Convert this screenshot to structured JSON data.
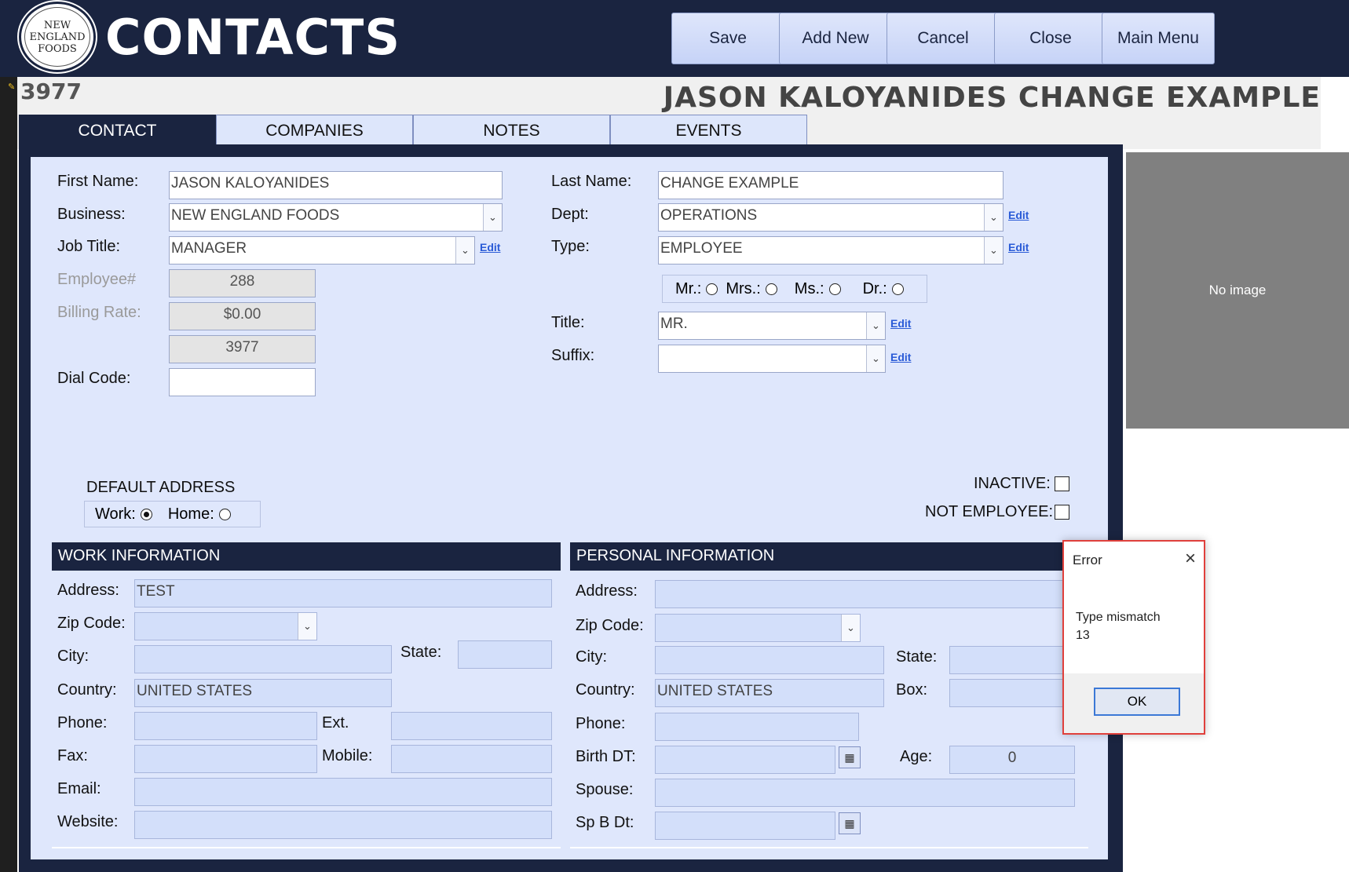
{
  "header": {
    "logo_lines": [
      "NEW",
      "ENGLAND",
      "FOODS"
    ],
    "title": "CONTACTS",
    "buttons": [
      "Save",
      "Add New",
      "Cancel",
      "Close",
      "Main Menu"
    ]
  },
  "record": {
    "id": "3977",
    "full_name": "JASON KALOYANIDES CHANGE EXAMPLE"
  },
  "tabs": [
    "CONTACT",
    "COMPANIES",
    "NOTES",
    "EVENTS"
  ],
  "contact": {
    "first_name_label": "First Name:",
    "first_name": "JASON KALOYANIDES",
    "business_label": "Business:",
    "business": "NEW ENGLAND FOODS",
    "job_title_label": "Job Title:",
    "job_title": "MANAGER",
    "employee_label": "Employee#",
    "employee_no": "288",
    "billing_label": "Billing Rate:",
    "billing_rate": "$0.00",
    "contact_id": "3977",
    "dial_code_label": "Dial Code:",
    "dial_code": "",
    "last_name_label": "Last Name:",
    "last_name": "CHANGE EXAMPLE",
    "dept_label": "Dept:",
    "dept": "OPERATIONS",
    "type_label": "Type:",
    "type": "EMPLOYEE",
    "edit_label": "Edit",
    "salutations": [
      "Mr.:",
      "Mrs.:",
      "Ms.:",
      "Dr.:"
    ],
    "title_label": "Title:",
    "title": "MR.",
    "suffix_label": "Suffix:",
    "suffix": "",
    "default_address_label": "DEFAULT ADDRESS",
    "work_label": "Work:",
    "home_label": "Home:",
    "inactive_label": "INACTIVE:",
    "not_employee_label": "NOT EMPLOYEE:"
  },
  "work": {
    "heading": "WORK INFORMATION",
    "address_label": "Address:",
    "address": "TEST",
    "zip_label": "Zip Code:",
    "zip": "",
    "city_label": "City:",
    "city": "",
    "state_label": "State:",
    "state": "",
    "country_label": "Country:",
    "country": "UNITED STATES",
    "phone_label": "Phone:",
    "ext_label": "Ext.",
    "fax_label": "Fax:",
    "mobile_label": "Mobile:",
    "email_label": "Email:",
    "website_label": "Website:"
  },
  "personal": {
    "heading": "PERSONAL INFORMATION",
    "address_label": "Address:",
    "zip_label": "Zip Code:",
    "city_label": "City:",
    "state_label": "State:",
    "country_label": "Country:",
    "country": "UNITED STATES",
    "box_label": "Box:",
    "phone_label": "Phone:",
    "birth_label": "Birth DT:",
    "age_label": "Age:",
    "age": "0",
    "spouse_label": "Spouse:",
    "spbdt_label": "Sp B Dt:"
  },
  "image_placeholder": "No image",
  "dialog": {
    "title": "Error",
    "message": "Type mismatch",
    "code": "13",
    "ok": "OK"
  },
  "icons": {
    "dropdown": "chevron-down-icon",
    "calendar": "calendar-icon",
    "close": "close-icon",
    "pencil": "pencil-icon"
  },
  "colors": {
    "header": "#1a2440",
    "panel": "#dfe7fc",
    "field_blue": "#d3dffa",
    "error_border": "#e0403c"
  }
}
